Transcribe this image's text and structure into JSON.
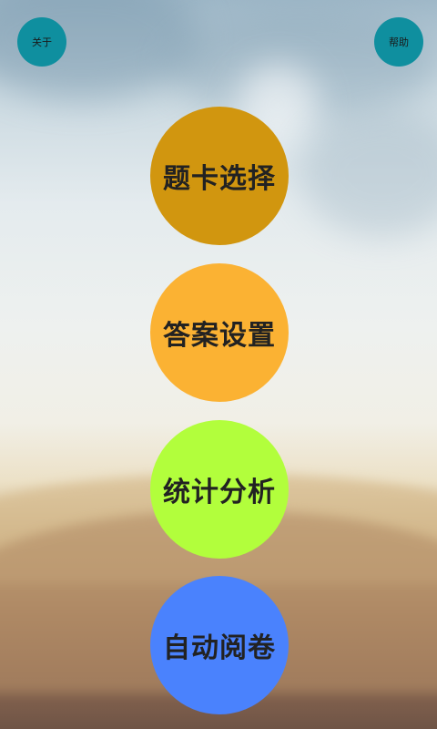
{
  "header": {
    "about_label": "关于",
    "help_label": "帮助"
  },
  "menu": {
    "items": [
      {
        "label": "题卡选择",
        "color": "#d1960f"
      },
      {
        "label": "答案设置",
        "color": "#fbb233"
      },
      {
        "label": "统计分析",
        "color": "#b2fe3c"
      },
      {
        "label": "自动阅卷",
        "color": "#4a82fd"
      }
    ]
  },
  "colors": {
    "corner_button": "#0f8f9f"
  }
}
